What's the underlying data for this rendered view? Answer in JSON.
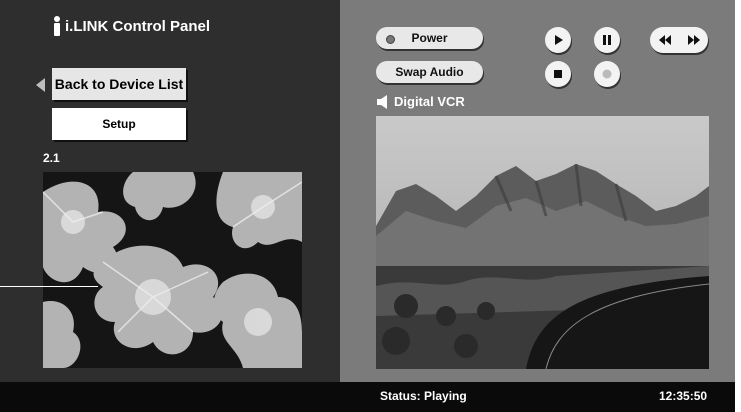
{
  "header": {
    "title": "i.LINK Control Panel"
  },
  "nav": {
    "back_label": "Back to Device List",
    "setup_label": "Setup"
  },
  "preview": {
    "channel": "2.1"
  },
  "controls": {
    "power_label": "Power",
    "swap_audio_label": "Swap Audio"
  },
  "device": {
    "name": "Digital VCR"
  },
  "status_bar": {
    "status": "Status: Playing",
    "time": "12:35:50"
  },
  "icons": {
    "play": "play-icon",
    "pause": "pause-icon",
    "stop": "stop-icon",
    "record": "record-icon",
    "rewind": "rewind-icon",
    "fast_forward": "fast-forward-icon",
    "speaker": "speaker-icon",
    "back": "left-arrow-icon"
  },
  "colors": {
    "left_panel": "#2e2e2e",
    "right_panel": "#7b7b7b",
    "bottom_bar": "#0a0a0a",
    "button_face": "#e8e8e8"
  }
}
